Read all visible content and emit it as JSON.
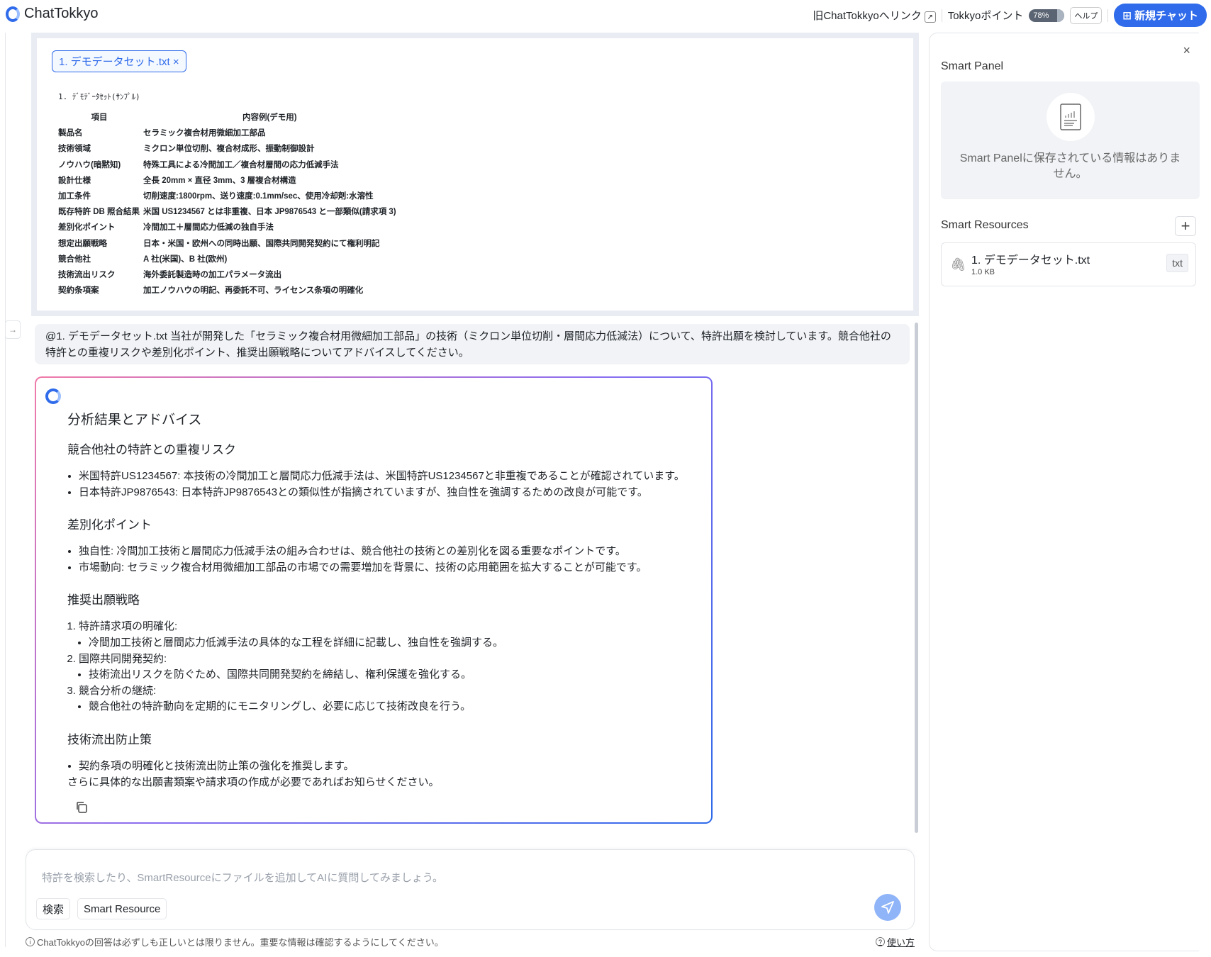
{
  "header": {
    "app_name": "ChatTokkyo",
    "old_link": "旧ChatTokkyoへリンク",
    "points_label": "Tokkyoポイント",
    "points_percent": "78%",
    "points_value": 78,
    "help": "ヘルプ",
    "new_chat": "新規チャット",
    "accent": "#2f6bea"
  },
  "document": {
    "chip": "1. デモデータセット.txt ×",
    "title": "1. ﾃﾞﾓﾃﾞｰﾀｾｯﾄ(ｻﾝﾌﾟﾙ)",
    "headers": [
      "項目",
      "内容例(デモ用)"
    ],
    "rows": [
      [
        "製品名",
        "セラミック複合材用微細加工部品"
      ],
      [
        "技術領域",
        "ミクロン単位切削、複合材成形、振動制御設計"
      ],
      [
        "ノウハウ(暗黙知)",
        "特殊工具による冷間加工／複合材層間の応力低減手法"
      ],
      [
        "設計仕様",
        "全長 20mm × 直径 3mm、3 層複合材構造"
      ],
      [
        "加工条件",
        "切削速度:1800rpm、送り速度:0.1mm/sec、使用冷却剤:水溶性"
      ],
      [
        "既存特許 DB 照合結果",
        "米国 US1234567 とは非重複、日本 JP9876543 と一部類似(請求項 3)"
      ],
      [
        "差別化ポイント",
        "冷間加工＋層間応力低減の独自手法"
      ],
      [
        "想定出願戦略",
        "日本・米国・欧州への同時出願、国際共同開発契約にて権利明記"
      ],
      [
        "競合他社",
        "A 社(米国)、B 社(欧州)"
      ],
      [
        "技術流出リスク",
        "海外委託製造時の加工パラメータ流出"
      ],
      [
        "契約条項案",
        "加工ノウハウの明記、再委託不可、ライセンス条項の明確化"
      ]
    ]
  },
  "user_message": "@1. デモデータセット.txt 当社が開発した「セラミック複合材用微細加工部品」の技術（ミクロン単位切削・層間応力低減法）について、特許出願を検討しています。競合他社の特許との重複リスクや差別化ポイント、推奨出願戦略についてアドバイスしてください。",
  "response": {
    "title": "分析結果とアドバイス",
    "s1": {
      "heading": "競合他社の特許との重複リスク",
      "items": [
        "米国特許US1234567: 本技術の冷間加工と層間応力低減手法は、米国特許US1234567と非重複であることが確認されています。",
        "日本特許JP9876543: 日本特許JP9876543との類似性が指摘されていますが、独自性を強調するための改良が可能です。"
      ]
    },
    "s2": {
      "heading": "差別化ポイント",
      "items": [
        "独自性: 冷間加工技術と層間応力低減手法の組み合わせは、競合他社の技術との差別化を図る重要なポイントです。",
        "市場動向: セラミック複合材用微細加工部品の市場での需要増加を背景に、技術の応用範囲を拡大することが可能です。"
      ]
    },
    "s3": {
      "heading": "推奨出願戦略",
      "items": [
        {
          "label": "特許請求項の明確化:",
          "sub": "冷間加工技術と層間応力低減手法の具体的な工程を詳細に記載し、独自性を強調する。"
        },
        {
          "label": "国際共同開発契約:",
          "sub": "技術流出リスクを防ぐため、国際共同開発契約を締結し、権利保護を強化する。"
        },
        {
          "label": "競合分析の継続:",
          "sub": "競合他社の特許動向を定期的にモニタリングし、必要に応じて技術改良を行う。"
        }
      ]
    },
    "s4": {
      "heading": "技術流出防止策",
      "items": [
        "契約条項の明確化と技術流出防止策の強化を推奨します。"
      ]
    },
    "closing": "さらに具体的な出願書類案や請求項の作成が必要であればお知らせください。"
  },
  "input": {
    "placeholder": "特許を検索したり、SmartResourceにファイルを追加してAIに質問してみましょう。",
    "search_btn": "検索",
    "resource_btn": "Smart Resource"
  },
  "footer": {
    "disclaimer": "ChatTokkyoの回答は必ずしも正しいとは限りません。重要な情報は確認するようにしてください。",
    "howto": "使い方"
  },
  "panel": {
    "smart_panel_title": "Smart Panel",
    "empty_text": "Smart Panelに保存されている情報はありません。",
    "resources_title": "Smart Resources",
    "resource": {
      "name": "1. デモデータセット.txt",
      "size": "1.0 KB",
      "type": "txt"
    }
  }
}
